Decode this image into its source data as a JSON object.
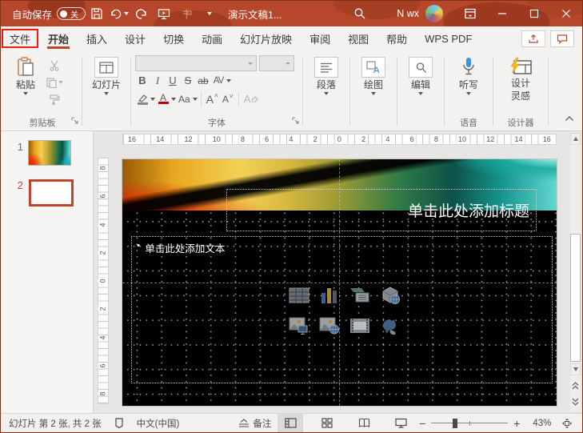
{
  "colors": {
    "accent": "#b7472a",
    "annotation_red": "#ee1b0e",
    "selection_red": "#c0452c",
    "dictate_blue": "#3f8fdc",
    "designer_yellow": "#f5ba1e"
  },
  "titlebar": {
    "autosave_label": "自动保存",
    "autosave_state": "关",
    "document_title": "演示文稿1...",
    "user_name": "N wx"
  },
  "tabs": {
    "items": [
      {
        "id": "file",
        "label": "文件",
        "annotated": true
      },
      {
        "id": "home",
        "label": "开始",
        "active": true
      },
      {
        "id": "insert",
        "label": "插入"
      },
      {
        "id": "design",
        "label": "设计"
      },
      {
        "id": "transitions",
        "label": "切换"
      },
      {
        "id": "animations",
        "label": "动画"
      },
      {
        "id": "slideshow",
        "label": "幻灯片放映"
      },
      {
        "id": "review",
        "label": "审阅"
      },
      {
        "id": "view",
        "label": "视图"
      },
      {
        "id": "help",
        "label": "帮助"
      },
      {
        "id": "wps-pdf",
        "label": "WPS PDF"
      }
    ]
  },
  "ribbon": {
    "paste_label": "粘贴",
    "clipboard_group_label": "剪贴板",
    "slides_label": "幻灯片",
    "bold": "B",
    "italic": "I",
    "underline": "U",
    "strike_s": "S",
    "strike_ab": "ab",
    "spacing": "AV",
    "change_case": "Aa",
    "font_color": "A",
    "grow_font": "A",
    "shrink_font": "A",
    "clear_format": "A",
    "font_group_label": "字体",
    "paragraph_label": "段落",
    "draw_label": "绘图",
    "editing_label": "编辑",
    "dictate_label": "听写",
    "voice_group_label": "语音",
    "design_ideas_line1": "设计",
    "design_ideas_line2": "灵感",
    "designer_group_label": "设计器"
  },
  "slides_panel": {
    "items": [
      {
        "number": "1",
        "selected": false
      },
      {
        "number": "2",
        "selected": true
      }
    ]
  },
  "rulers": {
    "horizontal": [
      "16",
      "14",
      "12",
      "10",
      "8",
      "6",
      "4",
      "2",
      "0",
      "2",
      "4",
      "6",
      "8",
      "10",
      "12",
      "14",
      "16"
    ],
    "vertical": [
      "8",
      "6",
      "4",
      "2",
      "0",
      "2",
      "4",
      "6",
      "8"
    ]
  },
  "slide": {
    "title_placeholder": "单击此处添加标题",
    "bullet": "•",
    "body_placeholder": "单击此处添加文本",
    "content_icons": [
      "insert-table",
      "insert-chart",
      "insert-smartart",
      "insert-3d-model",
      "insert-picture",
      "insert-online-picture",
      "insert-video",
      "insert-icons"
    ]
  },
  "statusbar": {
    "slide_info": "幻灯片 第 2 张, 共 2 张",
    "language": "中文(中国)",
    "notes_label": "备注",
    "zoom_level": "43%"
  }
}
